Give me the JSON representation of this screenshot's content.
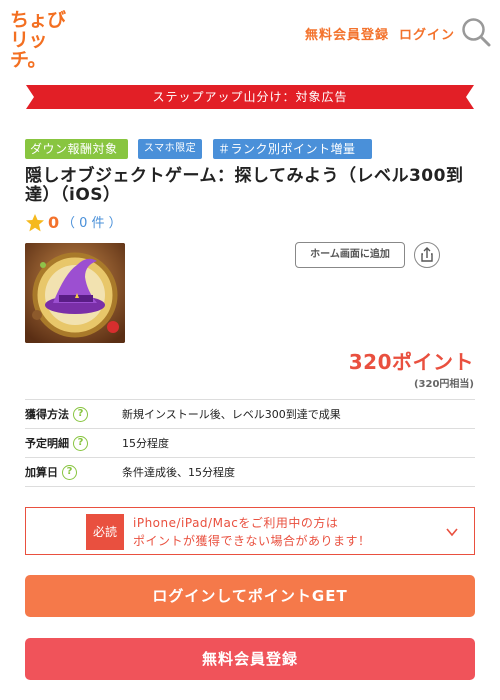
{
  "header": {
    "logo_line1": "ちょび",
    "logo_line2": "リッチ。",
    "register_label": "無料会員登録",
    "login_label": "ログイン",
    "search_icon": "search-icon"
  },
  "ribbon": {
    "text": "ステップアップ山分け：対象広告"
  },
  "tags": [
    {
      "label": "ダウン報酬対象"
    },
    {
      "label": "スマホ限定"
    },
    {
      "label": "＃ランク別ポイント増量"
    }
  ],
  "title": "隠しオブジェクトゲーム：探してみよう（レベル300到達）（iOS）",
  "rating": {
    "value": "0",
    "count": "（ 0 件 ）"
  },
  "actions": {
    "home_add_label": "ホーム画面に追加",
    "share_icon": "share-icon"
  },
  "points": {
    "value": "320ポイント",
    "yen": "(320円相当)"
  },
  "info": [
    {
      "label": "獲得方法",
      "value": "新規インストール後、レベル300到達で成果"
    },
    {
      "label": "予定明細",
      "value": "15分程度"
    },
    {
      "label": "加算日",
      "value": "条件達成後、15分程度"
    }
  ],
  "notice": {
    "badge": "必読",
    "line1": "iPhone/iPad/Macをご利用中の方は",
    "line2": "ポイントが獲得できない場合があります！"
  },
  "buttons": {
    "login_get": "ログインしてポイントGET",
    "register": "無料会員登録"
  },
  "colors": {
    "accent_orange": "#f3722c",
    "accent_red": "#e9503f",
    "tag_green": "#88c540",
    "tag_blue": "#4a90d9"
  }
}
